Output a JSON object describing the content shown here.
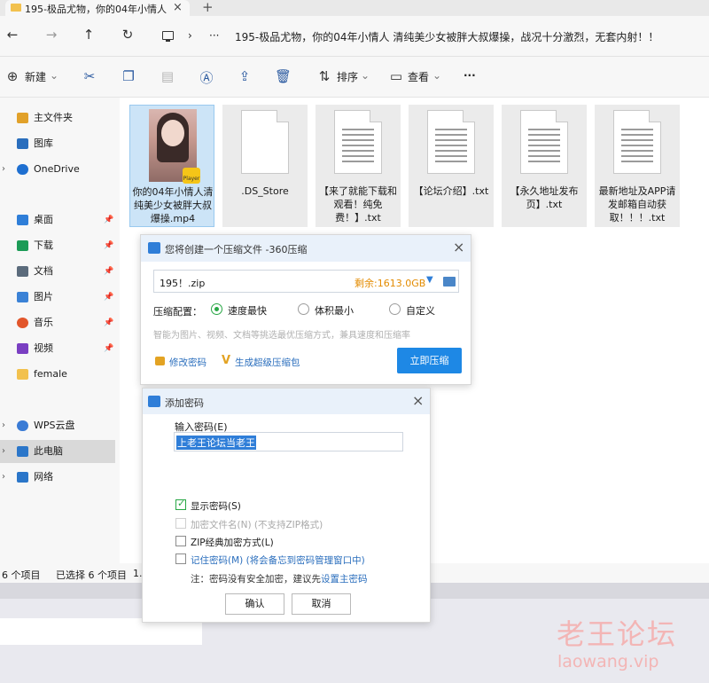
{
  "window": {
    "tab_title": "195-极品尤物，你的04年小情人",
    "tab_close": "×",
    "tab_new": "+"
  },
  "address": {
    "back": "←",
    "forward": "→",
    "up": "↑",
    "refresh": "↻",
    "chevron": "›",
    "more": "···",
    "path": "195-极品尤物，你的04年小情人 清纯美少女被胖大叔爆操，战况十分激烈，无套内射！！"
  },
  "toolbar": {
    "new_label": "新建",
    "sort_label": "排序",
    "view_label": "查看",
    "more_label": "···",
    "chevron": "⌄"
  },
  "sidebar": {
    "items": [
      {
        "label": "主文件夹",
        "color": "#e1a12a"
      },
      {
        "label": "图库",
        "color": "#2a6ebd"
      },
      {
        "label": "OneDrive",
        "color": "#1e6fd0"
      },
      {
        "label": "桌面",
        "color": "#2f7ed8"
      },
      {
        "label": "下载",
        "color": "#1c9b57"
      },
      {
        "label": "文档",
        "color": "#5b6b7c"
      },
      {
        "label": "图片",
        "color": "#3b82d6"
      },
      {
        "label": "音乐",
        "color": "#e2562b"
      },
      {
        "label": "视频",
        "color": "#7a3fc2"
      },
      {
        "label": "female",
        "color": "#f2c14e"
      },
      {
        "label": "WPS云盘",
        "color": "#3a7bd5"
      },
      {
        "label": "此电脑",
        "color": "#2b76c9"
      },
      {
        "label": "网络",
        "color": "#2b76c9"
      }
    ]
  },
  "files": [
    {
      "name": "你的04年小情人清纯美少女被胖大叔爆操.mp4",
      "player_badge": "Player"
    },
    {
      "name": ".DS_Store"
    },
    {
      "name": "【来了就能下载和观看！纯免费！】.txt"
    },
    {
      "name": "【论坛介绍】.txt"
    },
    {
      "name": "【永久地址发布页】.txt"
    },
    {
      "name": "最新地址及APP请发邮箱自动获取！！！.txt"
    }
  ],
  "status": {
    "count": "6 个项目",
    "selected": "已选择 6 个项目",
    "size_prefix": "1."
  },
  "compress_dialog": {
    "title": "您将创建一个压缩文件 -360压缩",
    "close": "×",
    "filename": "195！.zip",
    "free_space": "剩余:1613.0GB",
    "dropdown": "▼",
    "config_label": "压缩配置：",
    "options": [
      "速度最快",
      "体积最小",
      "自定义"
    ],
    "hint": "智能为图片、视频、文档等挑选最优压缩方式，兼具速度和压缩率",
    "change_password": "修改密码",
    "super_package": "生成超级压缩包",
    "compress_now": "立即压缩"
  },
  "password_dialog": {
    "title": "添加密码",
    "close": "×",
    "input_label": "输入密码(E)",
    "password_value": "上老王论坛当老王",
    "show_password": "显示密码(S)",
    "encrypt_filenames": "加密文件名(N) (不支持ZIP格式)",
    "zip_classic": "ZIP经典加密方式(L)",
    "remember_password": "记住密码(M) (将会备忘到密码管理窗口中)",
    "note_prefix": "注：密码没有安全加密，建议先",
    "note_link": "设置主密码",
    "ok": "确认",
    "cancel": "取消"
  },
  "watermark": {
    "line1": "老王论坛",
    "line2": "laowang.vip"
  }
}
